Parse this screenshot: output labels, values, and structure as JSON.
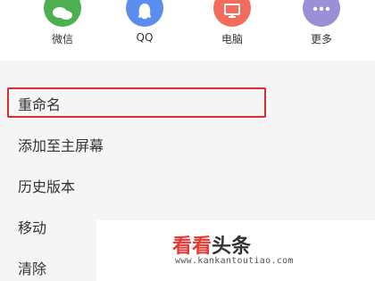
{
  "share": {
    "items": [
      {
        "label": "微信",
        "icon": "wechat-icon",
        "color": "#4caf50"
      },
      {
        "label": "QQ",
        "icon": "qq-icon",
        "color": "#5b8def"
      },
      {
        "label": "电脑",
        "icon": "monitor-icon",
        "color": "#f26b5b"
      },
      {
        "label": "更多",
        "icon": "more-icon",
        "color": "#9c8fd8"
      }
    ]
  },
  "menu": {
    "items": [
      {
        "label": "重命名"
      },
      {
        "label": "添加至主屏幕"
      },
      {
        "label": "历史版本"
      },
      {
        "label": "移动"
      },
      {
        "label": "清除"
      }
    ],
    "highlight_color": "#d32f2f"
  },
  "watermark": {
    "title_part1": "看看",
    "title_part2": "头条",
    "url": "www.kankantoutiao.com"
  }
}
